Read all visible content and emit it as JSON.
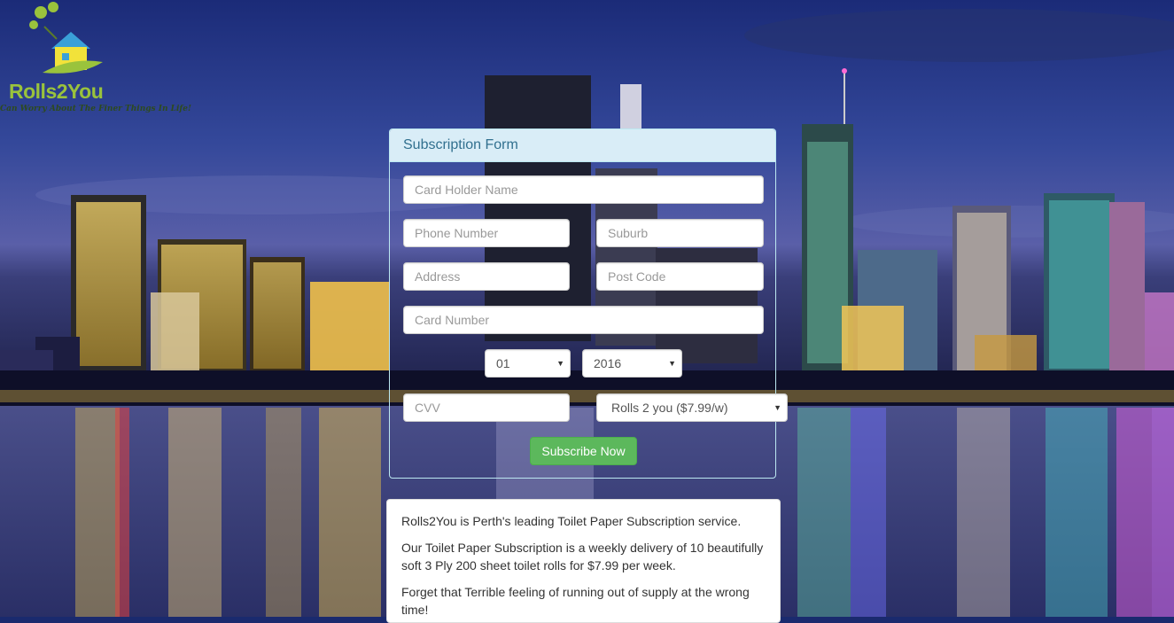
{
  "brand": {
    "name": "Rolls2You",
    "tagline": "Can Worry About The Finer Things In Life!",
    "logo_colors": {
      "green": "#9ac33c",
      "yellow": "#f2e23a",
      "blue": "#3aa0d8"
    }
  },
  "form": {
    "heading": "Subscription Form",
    "card_holder_placeholder": "Card Holder Name",
    "phone_placeholder": "Phone Number",
    "suburb_placeholder": "Suburb",
    "address_placeholder": "Address",
    "postcode_placeholder": "Post Code",
    "card_number_placeholder": "Card Number",
    "expiry_month": "01",
    "expiry_year": "2016",
    "cvv_placeholder": "CVV",
    "plan": "Rolls 2 you ($7.99/w)",
    "submit_label": "Subscribe Now"
  },
  "info": {
    "p1": "Rolls2You is Perth's leading Toilet Paper Subscription service.",
    "p2": "Our Toilet Paper Subscription is a weekly delivery of 10 beautifully soft 3 Ply 200 sheet toilet rolls for $7.99 per week.",
    "p3": "Forget that Terrible feeling of running out of supply at the wrong time!"
  },
  "colors": {
    "panel_heading_bg": "#d9edf7",
    "panel_heading_text": "#31708f",
    "button_green": "#5cb85c"
  }
}
